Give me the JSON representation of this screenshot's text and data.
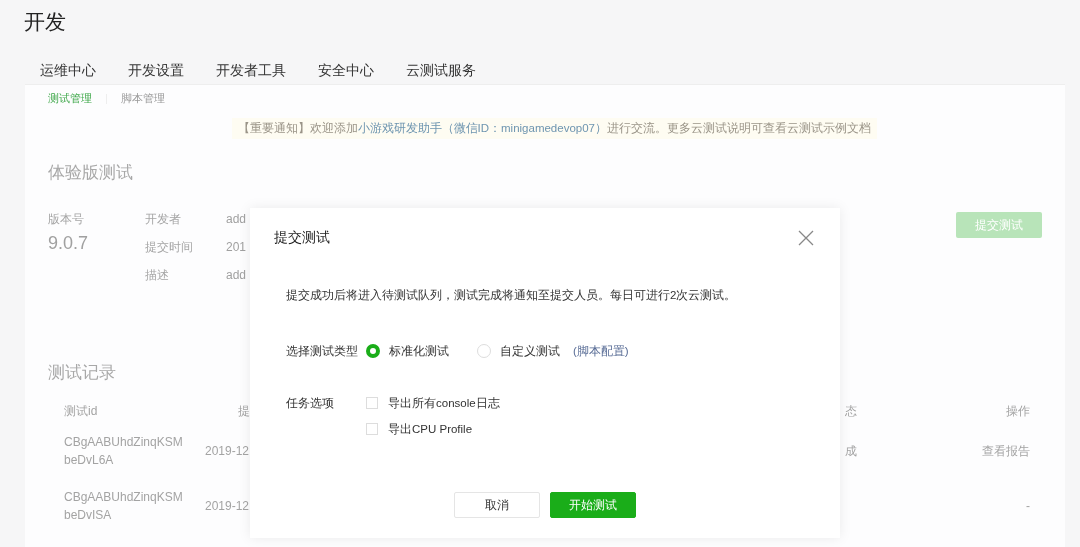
{
  "page_title": "开发",
  "nav_tabs": [
    "运维中心",
    "开发设置",
    "开发者工具",
    "安全中心",
    "云测试服务"
  ],
  "sub_tabs": [
    {
      "label": "测试管理",
      "selected": true
    },
    {
      "label": "脚本管理",
      "selected": false
    }
  ],
  "notice": {
    "prefix": "【重要通知】欢迎添加",
    "link": "小游戏研发助手（微信ID：minigamedevop07）",
    "suffix": "进行交流。更多云测试说明可查看云测试示例文档"
  },
  "trial_section": {
    "title": "体验版测试",
    "version_label": "版本号",
    "version": "9.0.7",
    "fields": [
      {
        "label": "开发者",
        "value": "add"
      },
      {
        "label": "提交时间",
        "value": "201"
      },
      {
        "label": "描述",
        "value": "add"
      }
    ],
    "submit_button": "提交测试"
  },
  "records": {
    "title": "测试记录",
    "columns": [
      "测试id",
      "提",
      "态",
      "操作"
    ],
    "rows": [
      {
        "id": "CBgAABUhdZinqKSM beDvL6A",
        "time": "2019-12",
        "status": "成",
        "action": "查看报告"
      },
      {
        "id": "CBgAABUhdZinqKSM beDvISA",
        "time": "2019-12",
        "status": "",
        "action": "-"
      }
    ]
  },
  "dialog": {
    "title": "提交测试",
    "description": "提交成功后将进入待测试队列，测试完成将通知至提交人员。每日可进行2次云测试。",
    "type_label": "选择测试类型",
    "types": [
      {
        "label": "标准化测试",
        "selected": true
      },
      {
        "label": "自定义测试",
        "selected": false,
        "link": "(脚本配置)"
      }
    ],
    "options_label": "任务选项",
    "options": [
      {
        "label": "导出所有console日志",
        "checked": false
      },
      {
        "label": "导出CPU Profile",
        "checked": false
      }
    ],
    "cancel": "取消",
    "confirm": "开始测试"
  }
}
